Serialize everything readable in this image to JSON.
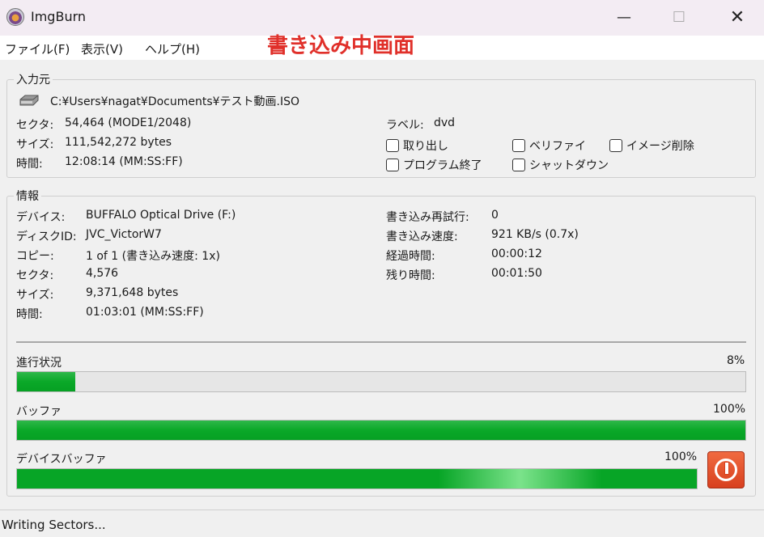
{
  "window": {
    "title": "ImgBurn",
    "minimize": "—",
    "maximize": "☐",
    "close": "✕"
  },
  "menu": [
    "ファイル(F)",
    "表示(V)",
    "ヘルプ(H)"
  ],
  "annotation": "書き込み中画面",
  "source": {
    "legend": "入力元",
    "path": "C:¥Users¥nagat¥Documents¥テスト動画.ISO",
    "rows": [
      {
        "label": "セクタ:",
        "value": "54,464 (MODE1/2048)"
      },
      {
        "label": "サイズ:",
        "value": "111,542,272 bytes"
      },
      {
        "label": "時間:",
        "value": "12:08:14 (MM:SS:FF)"
      }
    ],
    "volume_label": "ラベル:",
    "volume_value": "dvd",
    "options": [
      "取り出し",
      "ベリファイ",
      "イメージ削除",
      "プログラム終了",
      "シャットダウン"
    ]
  },
  "info": {
    "legend": "情報",
    "left_rows": [
      {
        "label": "デバイス:",
        "value": "BUFFALO Optical Drive (F:)"
      },
      {
        "label": "ディスクID:",
        "value": "JVC_VictorW7"
      },
      {
        "label": "コピー:",
        "value": "1 of 1 (書き込み速度: 1x)"
      },
      {
        "label": "セクタ:",
        "value": "4,576"
      },
      {
        "label": "サイズ:",
        "value": "9,371,648 bytes"
      },
      {
        "label": "時間:",
        "value": "01:03:01 (MM:SS:FF)"
      }
    ],
    "right_rows": [
      {
        "label": "書き込み再試行:",
        "value": "0"
      },
      {
        "label": "書き込み速度:",
        "value": "921 KB/s (0.7x)"
      },
      {
        "label": "経過時間:",
        "value": "00:00:12"
      },
      {
        "label": "残り時間:",
        "value": "00:01:50"
      }
    ]
  },
  "progress": {
    "label": "進行状況",
    "percent_text": "8%",
    "fraction": 0.08
  },
  "buffer": {
    "label": "バッファ",
    "percent_text": "100%",
    "fraction": 1.0
  },
  "device_buffer": {
    "label": "デバイスバッファ",
    "percent_text": "100%",
    "fraction": 1.0
  },
  "stop_icon": "power-stop-icon",
  "status": "Writing Sectors..."
}
